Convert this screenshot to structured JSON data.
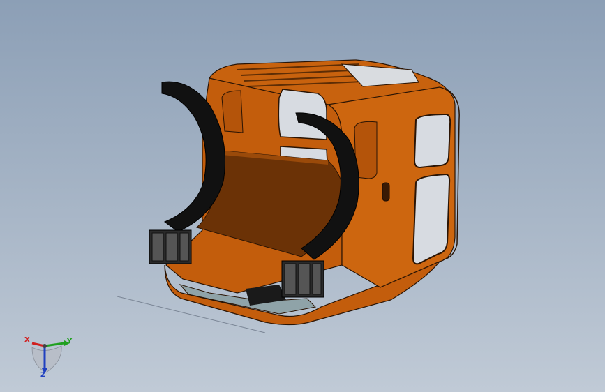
{
  "viewport": {
    "background_top": "#8c9fb6",
    "background_bottom": "#c0cad6"
  },
  "model": {
    "body_color": "#c8620e",
    "dark_color": "#6b3206",
    "fender_color": "#101010",
    "glass_color": "#d7dbe1"
  },
  "triad": {
    "x_label": "X",
    "y_label": "Y",
    "z_label": "Z",
    "x_color": "#d02020",
    "y_color": "#20a020",
    "z_color": "#2040c0"
  }
}
